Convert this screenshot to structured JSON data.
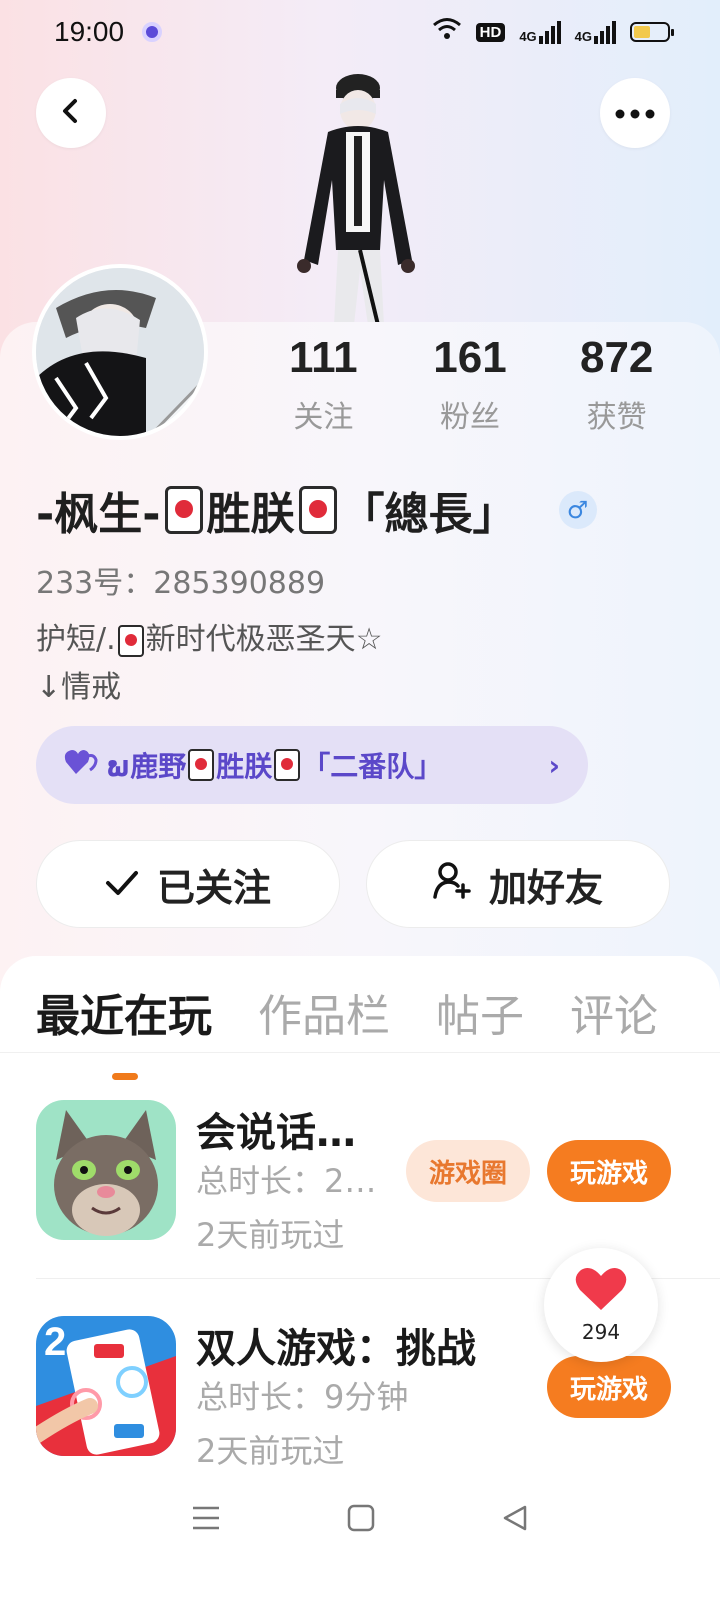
{
  "status_bar": {
    "time": "19:00",
    "hd": "HD",
    "signal1": "4G",
    "signal2": "4G"
  },
  "colors": {
    "accent": "#f57c20",
    "guild_text": "#5b48c9",
    "gender_blue": "#3b87e0"
  },
  "header": {
    "back_icon": "chevron-left-icon",
    "more_icon": "more-horizontal-icon"
  },
  "stats": [
    {
      "value": "111",
      "label": "关注"
    },
    {
      "value": "161",
      "label": "粉丝"
    },
    {
      "value": "872",
      "label": "获赞"
    }
  ],
  "profile": {
    "name_part1": "-枫生-",
    "name_part2": "胜朕",
    "name_part3": "「總長」",
    "gender_symbol": "♂",
    "uid": "233号：285390889",
    "bio_line1_a": "护短/.",
    "bio_line1_b": "新时代极恶圣天☆",
    "bio_line2": "↓情戒"
  },
  "guild": {
    "prefix": "ພ鹿野",
    "mid": "胜朕",
    "suffix": "「二番队」",
    "chevron": "›"
  },
  "actions": {
    "follow_label": "已关注",
    "add_friend_label": "加好友"
  },
  "tabs": [
    {
      "label": "最近在玩",
      "active": true
    },
    {
      "label": "作品栏",
      "active": false
    },
    {
      "label": "帖子",
      "active": false
    },
    {
      "label": "评论",
      "active": false
    }
  ],
  "games": [
    {
      "title": "会说话…",
      "duration": "总时长：2…",
      "last_played": "2天前玩过",
      "circle_label": "游戏圈",
      "play_label": "玩游戏"
    },
    {
      "title": "双人游戏：挑战",
      "duration": "总时长：9分钟",
      "last_played": "2天前玩过",
      "play_label": "玩游戏",
      "icon_number": "2"
    }
  ],
  "like_float": {
    "count": "294"
  },
  "nav": {
    "menu_icon": "menu-icon",
    "home_icon": "home-square-icon",
    "back_icon": "back-triangle-icon"
  }
}
